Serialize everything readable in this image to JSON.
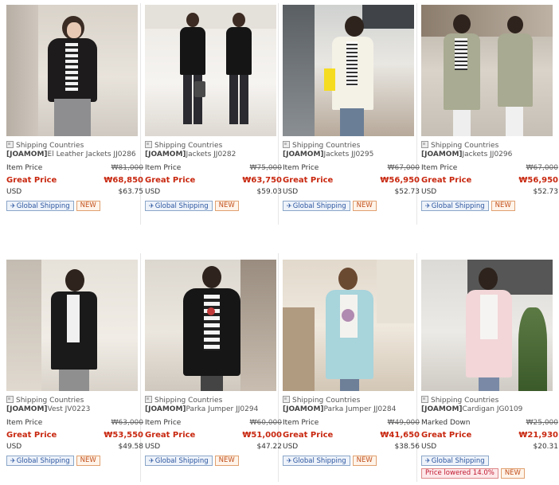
{
  "labels": {
    "shipping": "Shipping Countries",
    "item_price": "Item Price",
    "great_price": "Great Price",
    "usd": "USD",
    "global_shipping": "Global Shipping",
    "new": "NEW",
    "marked_down": "Marked Down",
    "brand": "[JOAMOM]"
  },
  "icons": {
    "shipping_icon": "shipping-countries-icon",
    "plane_icon": "airplane-icon"
  },
  "colors": {
    "great_price": "#c82810",
    "global_badge": "#2b55a0",
    "new_badge": "#c2501c",
    "lowered_badge": "#c01830"
  },
  "products": [
    {
      "name": "El Leather Jackets JJ0286",
      "item_price": "₩81,000",
      "great_price": "₩68,850",
      "usd": "$63.75",
      "photo": "woman in black leather jacket and grey pants"
    },
    {
      "name": "Jackets JJ0282",
      "item_price": "₩75,000",
      "great_price": "₩63,750",
      "usd": "$59.03",
      "photo": "woman in black double-breasted blazer"
    },
    {
      "name": "Jackets JJ0295",
      "item_price": "₩67,000",
      "great_price": "₩56,950",
      "usd": "$52.73",
      "photo": "woman in cream jacket with yellow clutch"
    },
    {
      "name": "Jackets JJ0296",
      "item_price": "₩67,000",
      "great_price": "₩56,950",
      "usd": "$52.73",
      "photo": "woman in khaki coat with striped top"
    },
    {
      "name": "Vest JV0223",
      "item_price": "₩63,000",
      "great_price": "₩53,550",
      "usd": "$49.58",
      "photo": "woman in long black vest"
    },
    {
      "name": "Parka Jumper JJ0294",
      "item_price": "₩60,000",
      "great_price": "₩51,000",
      "usd": "$47.22",
      "photo": "woman in black parka jumper"
    },
    {
      "name": "Parka Jumper JJ0284",
      "item_price": "₩49,000",
      "great_price": "₩41,650",
      "usd": "$38.56",
      "photo": "woman in light blue parka jumper"
    },
    {
      "name": "Cardigan JG0109",
      "price_label": "Marked Down",
      "item_price": "₩25,000",
      "great_price": "₩21,930",
      "usd": "$20.31",
      "lowered": "Price lowered 14.0%",
      "photo": "woman in pink cardigan"
    }
  ]
}
